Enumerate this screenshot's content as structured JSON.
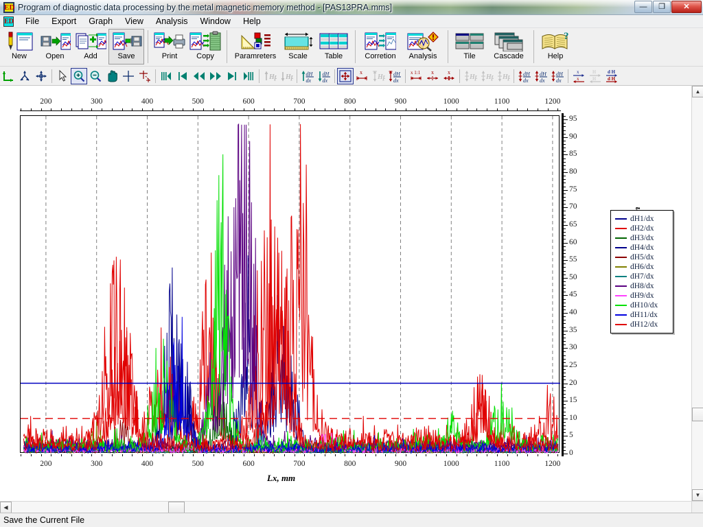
{
  "window": {
    "title": "Program of diagnostic data processing by the metal magnetic memory method - [PAS13PRA.mms]",
    "app_icon_label": "ED",
    "minimize_label": "—",
    "maximize_label": "❐",
    "close_label": "✕"
  },
  "menu": {
    "doc_icon_label": "ED",
    "items": [
      {
        "label": "File"
      },
      {
        "label": "Export"
      },
      {
        "label": "Graph"
      },
      {
        "label": "View"
      },
      {
        "label": "Analysis"
      },
      {
        "label": "Window"
      },
      {
        "label": "Help"
      }
    ]
  },
  "toolbar_main": {
    "groups": [
      {
        "buttons": [
          {
            "label": "New",
            "icon": "new-document-icon"
          },
          {
            "label": "Open",
            "icon": "open-file-icon"
          },
          {
            "label": "Add",
            "icon": "add-files-icon"
          },
          {
            "label": "Save",
            "icon": "save-file-icon",
            "state": "hover"
          }
        ]
      },
      {
        "buttons": [
          {
            "label": "Print",
            "icon": "print-icon"
          },
          {
            "label": "Copy",
            "icon": "copy-clipboard-icon"
          }
        ]
      },
      {
        "buttons": [
          {
            "label": "Paramreters",
            "icon": "parameters-icon"
          },
          {
            "label": "Scale",
            "icon": "scale-icon"
          },
          {
            "label": "Table",
            "icon": "table-icon"
          }
        ]
      },
      {
        "buttons": [
          {
            "label": "Corretion",
            "icon": "correction-icon"
          },
          {
            "label": "Analysis",
            "icon": "analysis-icon"
          }
        ]
      },
      {
        "buttons": [
          {
            "label": "Tile",
            "icon": "tile-windows-icon"
          },
          {
            "label": "Cascade",
            "icon": "cascade-windows-icon"
          }
        ]
      },
      {
        "buttons": [
          {
            "label": "Help",
            "icon": "help-book-icon"
          }
        ]
      }
    ]
  },
  "toolbar_tools": {
    "groups": [
      {
        "tools": [
          {
            "name": "axis-origin-tool",
            "glyph": "L",
            "enabled": true,
            "active": false
          },
          {
            "name": "branch-points-tool",
            "glyph": "Y",
            "enabled": true,
            "active": false
          },
          {
            "name": "move-all-tool",
            "glyph": "+",
            "enabled": true,
            "active": false
          }
        ]
      },
      {
        "tools": [
          {
            "name": "select-pointer-tool",
            "glyph": "arrow",
            "enabled": true,
            "active": false
          },
          {
            "name": "zoom-in-tool",
            "glyph": "zoom-plus",
            "enabled": true,
            "active": true
          },
          {
            "name": "zoom-out-tool",
            "glyph": "zoom-minus",
            "enabled": true,
            "active": false
          },
          {
            "name": "pan-hand-tool",
            "glyph": "hand",
            "enabled": true,
            "active": false
          },
          {
            "name": "crosshair-cursor-tool",
            "glyph": "cross",
            "enabled": true,
            "active": false
          },
          {
            "name": "add-point-tool",
            "glyph": "cross-plus",
            "enabled": true,
            "active": false
          }
        ]
      },
      {
        "tools": [
          {
            "name": "goto-first-record",
            "glyph": "|||<",
            "enabled": true,
            "active": false
          },
          {
            "name": "goto-previous-block",
            "glyph": "|<",
            "enabled": true,
            "active": false
          },
          {
            "name": "step-back",
            "glyph": "<<",
            "enabled": true,
            "active": false
          },
          {
            "name": "step-forward",
            "glyph": ">>",
            "enabled": true,
            "active": false
          },
          {
            "name": "goto-next-block",
            "glyph": ">|",
            "enabled": true,
            "active": false
          },
          {
            "name": "goto-last-record",
            "glyph": ">|||",
            "enabled": true,
            "active": false
          }
        ]
      },
      {
        "tools": [
          {
            "name": "hp-up-tool",
            "glyph": "up-Hp",
            "enabled": false,
            "active": false
          },
          {
            "name": "hp-down-tool",
            "glyph": "down-Hp",
            "enabled": false,
            "active": false
          }
        ]
      },
      {
        "tools": [
          {
            "name": "dhdx-up-tool",
            "glyph": "up-dHdx",
            "enabled": true,
            "active": false
          },
          {
            "name": "dhdx-down-tool",
            "glyph": "down-dHdx",
            "enabled": true,
            "active": false
          }
        ]
      },
      {
        "tools": [
          {
            "name": "fit-to-window-tool",
            "glyph": "fit-arrows",
            "enabled": true,
            "active": true
          },
          {
            "name": "scale-x-tool",
            "glyph": "x-width",
            "enabled": true,
            "active": false
          },
          {
            "name": "scale-hp-tool",
            "glyph": "Hp-height",
            "enabled": false,
            "active": false
          },
          {
            "name": "scale-dhdx-tool",
            "glyph": "dHdx-height",
            "enabled": true,
            "active": false
          }
        ]
      },
      {
        "tools": [
          {
            "name": "scale-x-one-to-one-tool",
            "glyph": "x-1-1",
            "enabled": true,
            "active": false
          },
          {
            "name": "scale-x-fit-tool",
            "glyph": "x-fit",
            "enabled": true,
            "active": false
          },
          {
            "name": "scale-x-compress-tool",
            "glyph": "x-compress",
            "enabled": true,
            "active": false
          }
        ]
      },
      {
        "tools": [
          {
            "name": "hp-scale-expand-tool",
            "glyph": "Hp-expand",
            "enabled": false,
            "active": false
          },
          {
            "name": "hp-scale-fit-tool",
            "glyph": "Hp-fit",
            "enabled": false,
            "active": false
          },
          {
            "name": "hp-scale-compress-tool",
            "glyph": "Hp-compress",
            "enabled": false,
            "active": false
          }
        ]
      },
      {
        "tools": [
          {
            "name": "dhdx-scale-expand-tool",
            "glyph": "dHdx-expand",
            "enabled": true,
            "active": false
          },
          {
            "name": "dhdx-scale-fit-tool",
            "glyph": "dHdx-fit",
            "enabled": true,
            "active": false
          },
          {
            "name": "dhdx-scale-compress-tool",
            "glyph": "dHdx-compress",
            "enabled": true,
            "active": false
          }
        ]
      },
      {
        "tools": [
          {
            "name": "invert-x-axis-tool",
            "glyph": "x-over-x",
            "enabled": true,
            "active": false
          },
          {
            "name": "invert-h-axis-tool",
            "glyph": "H-over-H",
            "enabled": false,
            "active": false
          },
          {
            "name": "invert-dh-axis-tool",
            "glyph": "dH-over-dH",
            "enabled": true,
            "active": false
          }
        ]
      }
    ]
  },
  "scrollbars": {
    "vertical": {
      "up_arrow": "▲",
      "down_arrow": "▼",
      "thumb_position_pct": 82
    },
    "horizontal": {
      "left_arrow": "◀",
      "right_arrow": "▶",
      "thumb_position_pct": 24
    }
  },
  "statusbar": {
    "text": "Save the Current File"
  },
  "chart_data": {
    "type": "line",
    "title": "",
    "xlabel": "Lx,  mm",
    "ylabel": "dH/dx,  (A/m) / mm",
    "xlim": [
      150,
      1215
    ],
    "ylim": [
      0,
      96
    ],
    "x_ticks": [
      200,
      300,
      400,
      500,
      600,
      700,
      800,
      900,
      1000,
      1100,
      1200
    ],
    "x_ticks_top": [
      200,
      300,
      400,
      500,
      600,
      700,
      800,
      900,
      1000,
      1100,
      1200
    ],
    "y_ticks": [
      0,
      5,
      10,
      15,
      20,
      25,
      30,
      35,
      40,
      45,
      50,
      55,
      60,
      65,
      70,
      75,
      80,
      85,
      90,
      95
    ],
    "grid": {
      "vertical_dashed": true,
      "horizontal": false,
      "grid_color": "#808080"
    },
    "legend_position": "right-outside",
    "threshold_lines": [
      {
        "name": "limit-upper",
        "value": 20,
        "color": "#0000c0",
        "style": "solid"
      },
      {
        "name": "limit-lower",
        "value": 10,
        "color": "#e00000",
        "style": "dashed"
      }
    ],
    "series": [
      {
        "name": "dH1/dx",
        "color": "#00008b",
        "baseline": 2.0,
        "noise": 2.6,
        "peaks": [
          [
            455,
            48,
            26
          ],
          [
            600,
            40,
            22
          ],
          [
            660,
            38,
            20
          ],
          [
            690,
            16,
            14
          ]
        ]
      },
      {
        "name": "dH2/dx",
        "color": "#e00000",
        "baseline": 4.0,
        "noise": 4.6,
        "peaks": [
          [
            340,
            50,
            30
          ],
          [
            430,
            26,
            28
          ],
          [
            520,
            40,
            24
          ],
          [
            640,
            60,
            34
          ],
          [
            700,
            64,
            30
          ],
          [
            1060,
            18,
            22
          ],
          [
            1190,
            14,
            18
          ]
        ]
      },
      {
        "name": "dH3/dx",
        "color": "#006400",
        "baseline": 1.2,
        "noise": 1.6,
        "peaks": [
          [
            545,
            22,
            18
          ]
        ]
      },
      {
        "name": "dH4/dx",
        "color": "#00008b",
        "baseline": 1.4,
        "noise": 1.8,
        "peaks": [
          [
            470,
            30,
            20
          ]
        ]
      },
      {
        "name": "dH5/dx",
        "color": "#8b0000",
        "baseline": 1.0,
        "noise": 1.3,
        "peaks": [
          [
            350,
            10,
            16
          ]
        ]
      },
      {
        "name": "dH6/dx",
        "color": "#808000",
        "baseline": 1.0,
        "noise": 1.2,
        "peaks": [
          [
            300,
            8,
            14
          ]
        ]
      },
      {
        "name": "dH7/dx",
        "color": "#008080",
        "baseline": 0.9,
        "noise": 1.1,
        "peaks": [
          [
            620,
            8,
            14
          ]
        ]
      },
      {
        "name": "dH8/dx",
        "color": "#5a0080",
        "baseline": 2.2,
        "noise": 3.0,
        "peaks": [
          [
            575,
            85,
            22
          ],
          [
            600,
            60,
            20
          ],
          [
            530,
            28,
            18
          ]
        ]
      },
      {
        "name": "dH9/dx",
        "color": "#ff40ff",
        "baseline": 1.1,
        "noise": 1.4,
        "peaks": [
          [
            760,
            6,
            18
          ]
        ]
      },
      {
        "name": "dH10/dx",
        "color": "#00e000",
        "baseline": 2.4,
        "noise": 3.2,
        "peaks": [
          [
            545,
            70,
            20
          ],
          [
            430,
            28,
            22
          ],
          [
            1100,
            14,
            26
          ],
          [
            1000,
            9,
            20
          ]
        ]
      },
      {
        "name": "dH11/dx",
        "color": "#0000e0",
        "baseline": 1.6,
        "noise": 2.2,
        "peaks": [
          [
            460,
            34,
            22
          ]
        ]
      },
      {
        "name": "dH12/dx",
        "color": "#e00000",
        "baseline": 2.8,
        "noise": 3.6,
        "peaks": [
          [
            350,
            44,
            26
          ],
          [
            660,
            50,
            28
          ],
          [
            1060,
            16,
            20
          ]
        ]
      }
    ]
  }
}
